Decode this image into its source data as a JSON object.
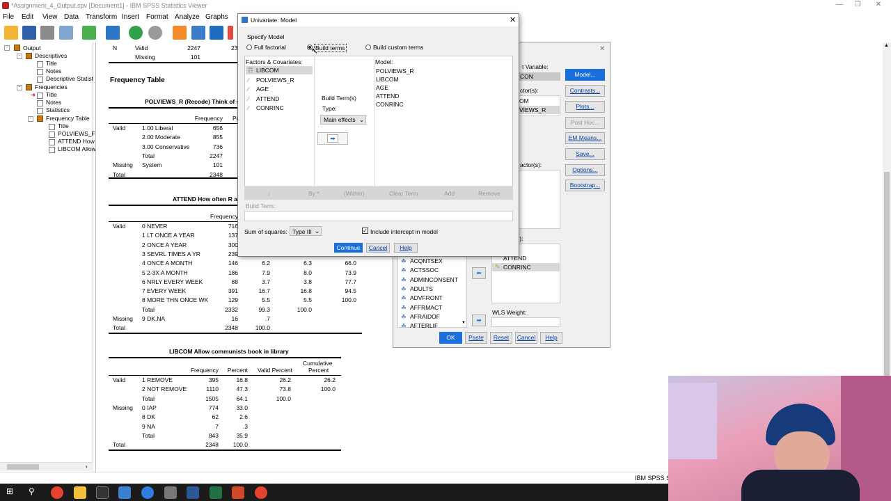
{
  "window": {
    "title": "*Assignment_4_Output.spv [Document1] - IBM SPSS Statistics Viewer"
  },
  "menu": [
    "File",
    "Edit",
    "View",
    "Data",
    "Transform",
    "Insert",
    "Format",
    "Analyze",
    "Graphs"
  ],
  "nav": {
    "items": [
      {
        "label": "Output"
      },
      {
        "label": "Descriptives"
      },
      {
        "label": "Title"
      },
      {
        "label": "Notes"
      },
      {
        "label": "Descriptive Statist"
      },
      {
        "label": "Frequencies"
      },
      {
        "label": "Title"
      },
      {
        "label": "Notes"
      },
      {
        "label": "Statistics"
      },
      {
        "label": "Frequency Table"
      },
      {
        "label": "Title"
      },
      {
        "label": "POLVIEWS_F"
      },
      {
        "label": "ATTEND How"
      },
      {
        "label": "LIBCOM Allow"
      }
    ]
  },
  "output": {
    "top": {
      "n": "N",
      "valid": "Valid",
      "missing": "Missing",
      "v1": "2247",
      "v2": "101",
      "v1b": "23"
    },
    "freq_title": "Frequency Table",
    "t1": {
      "title": "POLVIEWS_R (Recode) Think of self",
      "h_freq": "Frequency",
      "h_pe": "Pe",
      "rows": [
        {
          "g": "Valid",
          "l": "1.00 Liberal",
          "f": "656"
        },
        {
          "g": "",
          "l": "2.00 Moderate",
          "f": "855"
        },
        {
          "g": "",
          "l": "3.00 Conservative",
          "f": "736"
        },
        {
          "g": "",
          "l": "Total",
          "f": "2247"
        },
        {
          "g": "Missing",
          "l": "System",
          "f": "101"
        },
        {
          "g": "Total",
          "l": "",
          "f": "2348"
        }
      ]
    },
    "t2": {
      "title": "ATTEND How often R atte",
      "h_freq": "Frequency",
      "rows": [
        {
          "g": "Valid",
          "l": "0 NEVER",
          "f": "716",
          "p": "",
          "vp": "",
          "cp": ""
        },
        {
          "g": "",
          "l": "1 LT ONCE A YEAR",
          "f": "137",
          "p": "",
          "vp": "",
          "cp": ""
        },
        {
          "g": "",
          "l": "2 ONCE A YEAR",
          "f": "300",
          "p": "",
          "vp": "",
          "cp": ""
        },
        {
          "g": "",
          "l": "3 SEVRL TIMES A YR",
          "f": "239",
          "p": "",
          "vp": "",
          "cp": ""
        },
        {
          "g": "",
          "l": "4 ONCE A MONTH",
          "f": "146",
          "p": "6.2",
          "vp": "6.3",
          "cp": "66.0"
        },
        {
          "g": "",
          "l": "5 2-3X A MONTH",
          "f": "186",
          "p": "7.9",
          "vp": "8.0",
          "cp": "73.9"
        },
        {
          "g": "",
          "l": "6 NRLY EVERY WEEK",
          "f": "88",
          "p": "3.7",
          "vp": "3.8",
          "cp": "77.7"
        },
        {
          "g": "",
          "l": "7 EVERY WEEK",
          "f": "391",
          "p": "16.7",
          "vp": "16.8",
          "cp": "94.5"
        },
        {
          "g": "",
          "l": "8 MORE THN ONCE WK",
          "f": "129",
          "p": "5.5",
          "vp": "5.5",
          "cp": "100.0"
        },
        {
          "g": "",
          "l": "Total",
          "f": "2332",
          "p": "99.3",
          "vp": "100.0",
          "cp": ""
        },
        {
          "g": "Missing",
          "l": "9 DK,NA",
          "f": "16",
          "p": ".7",
          "vp": "",
          "cp": ""
        },
        {
          "g": "Total",
          "l": "",
          "f": "2348",
          "p": "100.0",
          "vp": "",
          "cp": ""
        }
      ]
    },
    "t3": {
      "title": "LIBCOM Allow communists book in library",
      "headers": {
        "freq": "Frequency",
        "pct": "Percent",
        "vp": "Valid Percent",
        "cp1": "Cumulative",
        "cp2": "Percent"
      },
      "rows": [
        {
          "g": "Valid",
          "l": "1 REMOVE",
          "f": "395",
          "p": "16.8",
          "vp": "26.2",
          "cp": "26.2"
        },
        {
          "g": "",
          "l": "2 NOT REMOVE",
          "f": "1110",
          "p": "47.3",
          "vp": "73.8",
          "cp": "100.0"
        },
        {
          "g": "",
          "l": "Total",
          "f": "1505",
          "p": "64.1",
          "vp": "100.0",
          "cp": ""
        },
        {
          "g": "Missing",
          "l": "0 IAP",
          "f": "774",
          "p": "33.0",
          "vp": "",
          "cp": ""
        },
        {
          "g": "",
          "l": "8 DK",
          "f": "62",
          "p": "2.6",
          "vp": "",
          "cp": ""
        },
        {
          "g": "",
          "l": "9 NA",
          "f": "7",
          "p": ".3",
          "vp": "",
          "cp": ""
        },
        {
          "g": "",
          "l": "Total",
          "f": "843",
          "p": "35.9",
          "vp": "",
          "cp": ""
        },
        {
          "g": "Total",
          "l": "",
          "f": "2348",
          "p": "100.0",
          "vp": "",
          "cp": ""
        }
      ]
    }
  },
  "univariate": {
    "dep_label": "t Variable:",
    "dep_value": "CON",
    "fixed_label": "ctor(s):",
    "fixed_items": [
      "OM",
      "VIEWS_R"
    ],
    "random_label": "actor(s):",
    "cov_label": "s):",
    "cov_items": [
      "ATTEND",
      "CONRINC"
    ],
    "vars": [
      "ACQNTSEX",
      "ACTSSOC",
      "ADMINCONSENT",
      "ADULTS",
      "ADVFRONT",
      "AFFRMACT",
      "AFRAIDOF",
      "AFTERLIF"
    ],
    "wls_label": "WLS Weight:",
    "side_buttons": [
      {
        "label": "Model...",
        "state": "active"
      },
      {
        "label": "Contrasts...",
        "state": "normal"
      },
      {
        "label": "Plots...",
        "state": "normal"
      },
      {
        "label": "Post Hoc...",
        "state": "disabled"
      },
      {
        "label": "EM Means...",
        "state": "normal"
      },
      {
        "label": "Save...",
        "state": "normal"
      },
      {
        "label": "Options...",
        "state": "normal"
      },
      {
        "label": "Bootstrap...",
        "state": "normal"
      }
    ],
    "bottom_buttons": {
      "ok": "OK",
      "paste": "Paste",
      "reset": "Reset",
      "cancel": "Cancel",
      "help": "Help"
    }
  },
  "model_dialog": {
    "title": "Univariate: Model",
    "specify": "Specify Model",
    "radios": {
      "full": "Full factorial",
      "build": "Build terms",
      "custom": "Build custom terms",
      "selected": "build"
    },
    "factors_label": "Factors & Covariates:",
    "factors": [
      "LIBCOM",
      "POLVIEWS_R",
      "AGE",
      "ATTEND",
      "CONRINC"
    ],
    "build_terms_label": "Build Term(s)",
    "type_label": "Type:",
    "type_value": "Main effects",
    "model_label": "Model:",
    "model_items": [
      "POLVIEWS_R",
      "LIBCOM",
      "AGE",
      "ATTEND",
      "CONRINC"
    ],
    "row_buttons": {
      "down": "↓",
      "by": "By *",
      "within": "(Within)",
      "clear": "Clear Term",
      "add": "Add",
      "remove": "Remove"
    },
    "build_term_label": "Build Term:",
    "ss_label": "Sum of squares:",
    "ss_value": "Type III",
    "intercept_label": "Include intercept in model",
    "buttons": {
      "continue": "Continue",
      "cancel": "Cancel",
      "help": "Help"
    }
  },
  "status": {
    "text": "IBM SPSS S"
  },
  "colors": {
    "accent": "#1a6fdc",
    "taskbar": "#1b1b1b",
    "selection": "#d8d8d8"
  }
}
